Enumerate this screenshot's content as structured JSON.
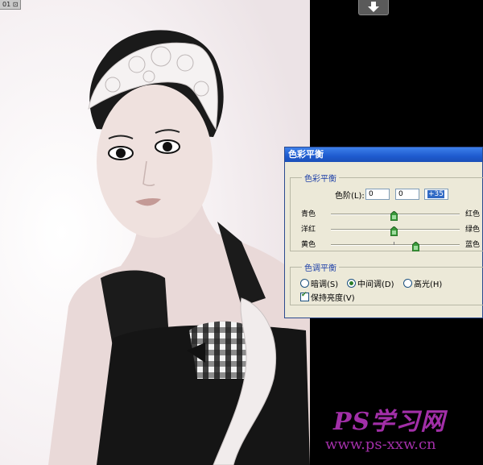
{
  "document": {
    "tab_label": "01 ⊡"
  },
  "dialog": {
    "title": "色彩平衡",
    "balance_group": {
      "legend": "色彩平衡",
      "levels_label": "色阶(L):",
      "levels": [
        "0",
        "0",
        "+35"
      ]
    },
    "sliders": [
      {
        "left": "青色",
        "right": "红色",
        "value": 0
      },
      {
        "left": "洋红",
        "right": "绿色",
        "value": 0
      },
      {
        "left": "黄色",
        "right": "蓝色",
        "value": 35
      }
    ],
    "tone_group": {
      "legend": "色调平衡",
      "options": [
        "暗调(S)",
        "中间调(D)",
        "高光(H)"
      ],
      "selected": "中间调(D)",
      "preserve_label": "保持亮度(V)",
      "preserve_checked": true
    }
  },
  "watermark": {
    "brand": "PS学习网",
    "url": "www.ps-xxw.cn"
  },
  "icons": {
    "download": "download-arrow-icon",
    "slider_thumb": "slider-thumb-icon"
  },
  "colors": {
    "titlebar": "#1e5bcf",
    "dialog_bg": "#ece9d8",
    "watermark": "#a22fa8",
    "workspace": "#000000"
  }
}
